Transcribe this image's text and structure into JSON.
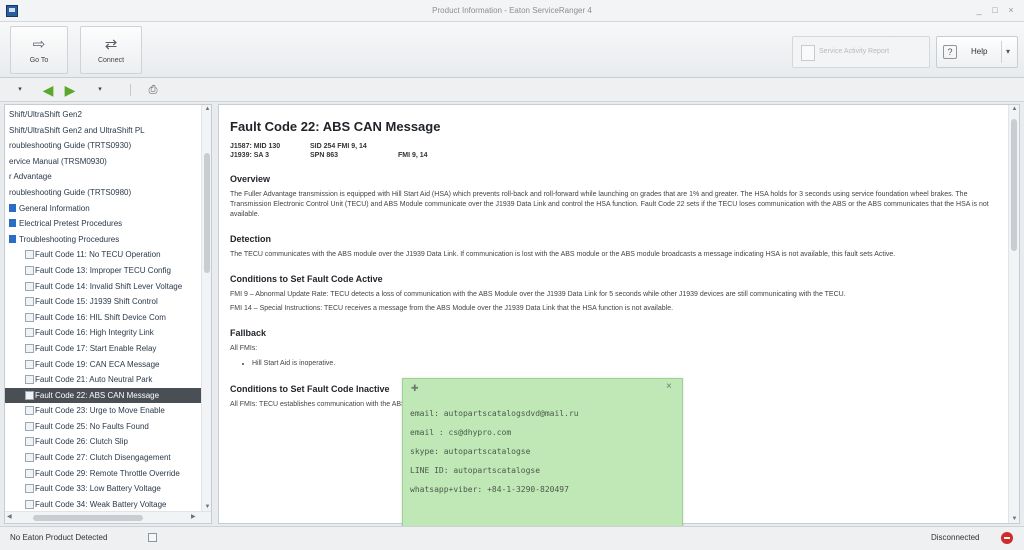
{
  "window": {
    "title": "Product Information - Eaton ServiceRanger 4",
    "minimize": "_",
    "restore": "□",
    "close": "×"
  },
  "ribbon": {
    "goto_label": "Go To",
    "connect_label": "Connect",
    "report_label": "Service Activity Report",
    "help_label": "Help",
    "help_icon": "?",
    "help_dropdown": "▾"
  },
  "nav": {
    "menu_icon": "▾",
    "back_icon": "◀",
    "forward_icon": "▶",
    "history_icon": "▾",
    "print_icon": "⎙"
  },
  "tree": {
    "items": [
      {
        "label": "Shift/UltraShift Gen2",
        "level": 0,
        "selected": false
      },
      {
        "label": "Shift/UltraShift Gen2 and UltraShift PL",
        "level": 0,
        "selected": false
      },
      {
        "label": "roubleshooting Guide (TRTS0930)",
        "level": 0,
        "selected": false
      },
      {
        "label": "ervice Manual (TRSM0930)",
        "level": 0,
        "selected": false
      },
      {
        "label": "r Advantage",
        "level": 0,
        "selected": false
      },
      {
        "label": "roubleshooting Guide (TRTS0980)",
        "level": 0,
        "selected": false
      },
      {
        "label": "General Information",
        "level": 1,
        "selected": false
      },
      {
        "label": "Electrical Pretest Procedures",
        "level": 1,
        "selected": false
      },
      {
        "label": "Troubleshooting Procedures",
        "level": 1,
        "selected": false
      },
      {
        "label": "Fault Code 11: No TECU Operation",
        "level": 2,
        "selected": false
      },
      {
        "label": "Fault Code 13: Improper TECU Config",
        "level": 2,
        "selected": false
      },
      {
        "label": "Fault Code 14: Invalid Shift Lever Voltage",
        "level": 2,
        "selected": false
      },
      {
        "label": "Fault Code 15: J1939 Shift Control",
        "level": 2,
        "selected": false
      },
      {
        "label": "Fault Code 16: HIL Shift Device Com",
        "level": 2,
        "selected": false
      },
      {
        "label": "Fault Code 16: High Integrity Link",
        "level": 2,
        "selected": false
      },
      {
        "label": "Fault Code 17: Start Enable Relay",
        "level": 2,
        "selected": false
      },
      {
        "label": "Fault Code 19: CAN ECA Message",
        "level": 2,
        "selected": false
      },
      {
        "label": "Fault Code 21: Auto Neutral Park",
        "level": 2,
        "selected": false
      },
      {
        "label": "Fault Code 22: ABS CAN Message",
        "level": 2,
        "selected": true
      },
      {
        "label": "Fault Code 23: Urge to Move Enable",
        "level": 2,
        "selected": false
      },
      {
        "label": "Fault Code 25: No Faults Found",
        "level": 2,
        "selected": false
      },
      {
        "label": "Fault Code 26: Clutch Slip",
        "level": 2,
        "selected": false
      },
      {
        "label": "Fault Code 27: Clutch Disengagement",
        "level": 2,
        "selected": false
      },
      {
        "label": "Fault Code 29: Remote Throttle Override",
        "level": 2,
        "selected": false
      },
      {
        "label": "Fault Code 33: Low Battery Voltage",
        "level": 2,
        "selected": false
      },
      {
        "label": "Fault Code 34: Weak Battery Voltage",
        "level": 2,
        "selected": false
      }
    ]
  },
  "doc": {
    "title": "Fault Code 22: ABS CAN Message",
    "pid_row1": [
      "J1587: MID 130",
      "SID 254 FMI 9, 14"
    ],
    "pid_row2": [
      "J1939: SA 3",
      "SPN 863",
      "FMI 9, 14"
    ],
    "overview_heading": "Overview",
    "overview_text": "The Fuller Advantage transmission is equipped with Hill Start Aid (HSA) which prevents roll-back and roll-forward while launching on grades that are 1% and greater. The HSA holds for 3 seconds using service foundation wheel brakes. The Transmission Electronic Control Unit (TECU) and ABS Module communicate over the J1939 Data Link and control the HSA function. Fault Code 22 sets if the TECU loses communication with the ABS or the ABS communicates that the HSA is not available.",
    "detection_heading": "Detection",
    "detection_text": "The TECU communicates with the ABS module over the J1939 Data Link. If communication is lost with the ABS module or the ABS module broadcasts a message indicating HSA is not available, this fault sets Active.",
    "conditions_heading": "Conditions to Set Fault Code Active",
    "conditions_text1": "FMI 9 – Abnormal Update Rate: TECU detects a loss of communication with the ABS Module over the J1939 Data Link for 5 seconds while other J1939 devices are still communicating with the TECU.",
    "conditions_text2": "FMI 14 – Special Instructions: TECU receives a message from the ABS Module over the J1939 Data Link that the HSA function is not available.",
    "fallback_heading": "Fallback",
    "fallback_text": "All FMIs:",
    "fallback_bullet": "Hill Start Aid is inoperative.",
    "conditions_inactive_heading": "Conditions to Set Fault Code Inactive",
    "conditions_inactive_text": "All FMIs: TECU establishes communication with the ABS Module over the J1939 Data Link and the ABS indicates that HSA is available."
  },
  "popup": {
    "pin_icon": "✚",
    "close_icon": "×",
    "lines": [
      "email: autopartscatalogsdvd@mail.ru",
      "email : cs@dhypro.com",
      "skype: autopartscatalogse",
      "LINE ID: autopartscatalogse",
      "whatsapp+viber: +84-1-3290-820497"
    ]
  },
  "status": {
    "left_text": "No Eaton Product Detected",
    "right_text": "Disconnected"
  },
  "colors": {
    "popup_bg": "#bfe8b6",
    "selected_item_bg": "#4a4f55",
    "nav_arrow": "#5aa829",
    "disconnected": "#d22a2a"
  }
}
